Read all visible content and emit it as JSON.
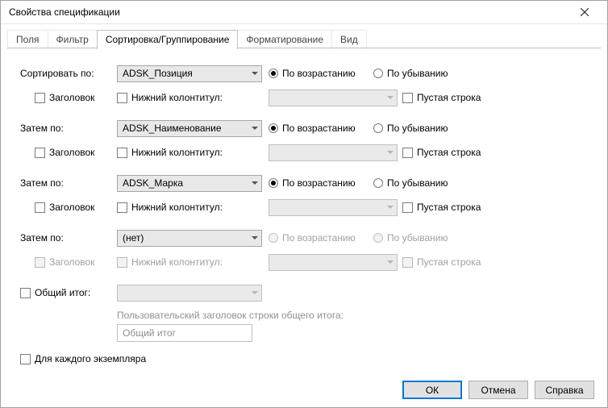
{
  "title": "Свойства спецификации",
  "tabs": [
    {
      "label": "Поля"
    },
    {
      "label": "Фильтр"
    },
    {
      "label": "Сортировка/Группирование"
    },
    {
      "label": "Форматирование"
    },
    {
      "label": "Вид"
    }
  ],
  "labels": {
    "sort_by": "Сортировать по:",
    "then_by": "Затем по:",
    "header": "Заголовок",
    "footer": "Нижний колонтитул:",
    "ascending": "По возрастанию",
    "descending": "По убыванию",
    "blank_line": "Пустая строка",
    "grand_total": "Общий итог:",
    "grand_hint": "Пользовательский заголовок строки общего итога:",
    "grand_value": "Общий итог",
    "per_instance": "Для каждого экземпляра"
  },
  "sort_groups": [
    {
      "field": "ADSK_Позиция",
      "asc": true,
      "enabled": true
    },
    {
      "field": "ADSK_Наименование",
      "asc": true,
      "enabled": true
    },
    {
      "field": "ADSK_Марка",
      "asc": true,
      "enabled": true
    },
    {
      "field": "(нет)",
      "asc": true,
      "enabled": false
    }
  ],
  "buttons": {
    "ok": "ОК",
    "cancel": "Отмена",
    "help": "Справка"
  }
}
